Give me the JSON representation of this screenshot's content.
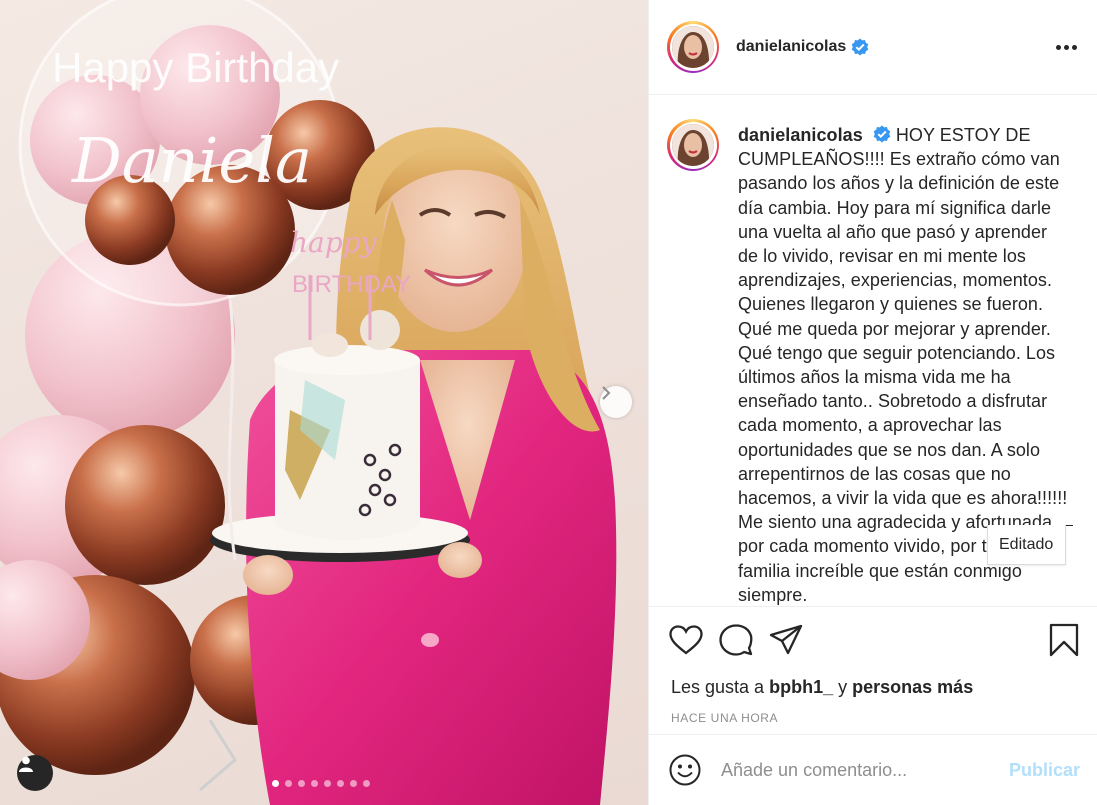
{
  "post": {
    "username": "danielanicolas",
    "verified": true,
    "caption_text": "HOY ESTOY DE CUMPLEAÑOS!!!! Es extraño cómo van pasando los años y la definición de este día cambia. Hoy para mí significa darle una vuelta al año que pasó y aprender de lo vivido, revisar en mi mente los aprendizajes, experiencias, momentos. Quienes llegaron y quienes se fueron. Qué me queda por mejorar y aprender. Qué tengo que seguir potenciando. Los últimos años la misma vida me ha enseñado tanto.. Sobretodo a disfrutar cada momento, a aprovechar las oportunidades que se nos dan. A solo arrepentirnos de las cosas que no hacemos, a vivir la vida que es ahora!!!!!! Me siento una agradecida y afortunada por cada momento vivido, por tener una familia increíble que están conmigo siempre.",
    "tooltip": "Editado",
    "likes_prefix": "Les gusta a",
    "likes_user": "bpbh1_",
    "likes_joiner": "y",
    "likes_others": "personas más",
    "timestamp": "HACE UNA HORA",
    "comment_placeholder": "Añade un comentario...",
    "publish_label": "Publicar"
  },
  "photo": {
    "balloon_text_top": "Happy Birthday",
    "balloon_text_name": "Daniela",
    "topper_text_1": "happy",
    "topper_text_2": "BIRTHDAY",
    "carousel_total": 8,
    "carousel_active": 1
  },
  "icons": {
    "verified": "verified-badge-icon",
    "more": "more-options-icon",
    "like": "heart-icon",
    "comment": "comment-icon",
    "share": "paper-plane-icon",
    "save": "bookmark-icon",
    "emoji": "emoji-icon",
    "next": "chevron-right-icon",
    "tag": "user-tag-icon"
  },
  "colors": {
    "verified": "#3897f0",
    "publish_disabled": "#b2dffc",
    "timestamp": "#8e8e8e"
  }
}
